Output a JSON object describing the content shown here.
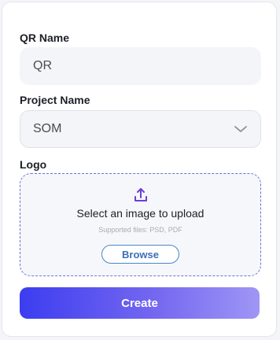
{
  "form": {
    "qr_name_label": "QR Name",
    "qr_name_value": "QR",
    "project_name_label": "Project Name",
    "project_name_value": "SOM",
    "logo_label": "Logo"
  },
  "upload": {
    "icon": "upload-icon",
    "title": "Select an image to upload",
    "hint": "Supported files: PSD, PDF",
    "browse_label": "Browse"
  },
  "actions": {
    "create_label": "Create"
  },
  "colors": {
    "dropzone_border": "#6b72d8",
    "accent_start": "#3c3df0",
    "accent_end": "#9f96f5",
    "browse_border": "#4a86c8"
  }
}
